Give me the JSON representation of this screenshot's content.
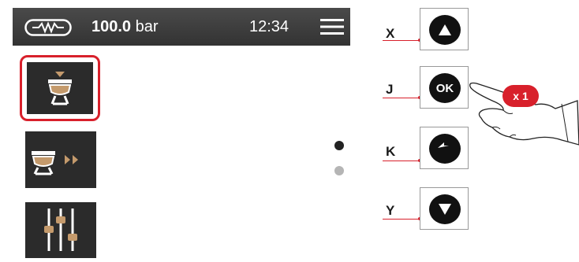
{
  "status_bar": {
    "heater_icon": "heater-icon",
    "pressure_value": "100.0",
    "pressure_unit": "bar",
    "time": "12:34",
    "menu_icon": "menu-icon"
  },
  "menu": {
    "items": [
      {
        "name": "single-cup-icon",
        "selected": true
      },
      {
        "name": "cup-forward-icon",
        "selected": false
      },
      {
        "name": "settings-sliders-icon",
        "selected": false
      }
    ]
  },
  "page_indicator": {
    "pages": 2,
    "current_page": 1
  },
  "keys": [
    {
      "label": "X",
      "symbol": "up-arrow-icon"
    },
    {
      "label": "J",
      "symbol": "ok",
      "text": "OK"
    },
    {
      "label": "K",
      "symbol": "back-arrow-icon"
    },
    {
      "label": "Y",
      "symbol": "down-arrow-icon"
    }
  ],
  "press_badge": "x 1",
  "colors": {
    "accent": "#d8202b",
    "tile": "#2b2b2b",
    "bar": "#3b3b3b",
    "icon_tan": "#c49a6c",
    "key": "#111111"
  }
}
